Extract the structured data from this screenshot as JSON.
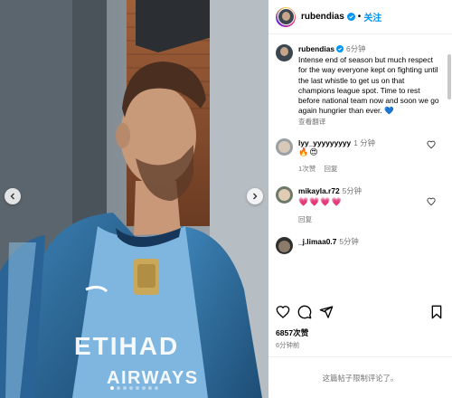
{
  "post": {
    "username": "rubendias",
    "follow_label": "关注",
    "separator": "•"
  },
  "caption": {
    "username": "rubendias",
    "time": "6分钟",
    "text": "Intense end of season but much respect for the way everyone kept on fighting until the last whistle to get us on that champions league spot. Time to rest before national team now and soon we go again hungrier than ever. 💙",
    "translate_label": "查看翻译"
  },
  "comments": [
    {
      "username": "lyy_yyyyyyyyy",
      "time": "1 分钟",
      "text": "🔥😍",
      "likes": "1次赞",
      "reply": "回复"
    },
    {
      "username": "mikayla.r72",
      "time": "5分钟",
      "text": "💗💗💗💗",
      "reply": "回复"
    },
    {
      "username": "_j.limaa0.7",
      "time": "5分钟"
    }
  ],
  "actions": {
    "icons": [
      "heart-icon",
      "comment-icon",
      "share-icon",
      "bookmark-icon"
    ]
  },
  "stats": {
    "likes": "6857次赞",
    "time_ago": "6分钟前"
  },
  "footer": {
    "text": "这篇帖子限制评论了。"
  },
  "carousel": {
    "slide_count": 8,
    "active_index": 0
  },
  "colors": {
    "follow": "#0095f6",
    "verified": "#0095f6",
    "jersey": "#7fb6df",
    "jacket": "#2f6ea0"
  }
}
